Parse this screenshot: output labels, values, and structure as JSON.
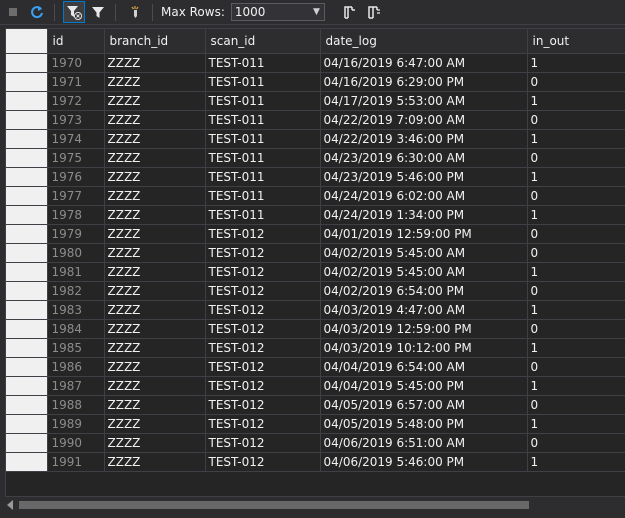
{
  "toolbar": {
    "max_rows_label": "Max Rows:",
    "max_rows_value": "1000"
  },
  "columns": [
    "id",
    "branch_id",
    "scan_id",
    "date_log",
    "in_out"
  ],
  "rows": [
    [
      "1970",
      "ZZZZ",
      "TEST-011",
      "04/16/2019 6:47:00 AM",
      "1"
    ],
    [
      "1971",
      "ZZZZ",
      "TEST-011",
      "04/16/2019 6:29:00 PM",
      "0"
    ],
    [
      "1972",
      "ZZZZ",
      "TEST-011",
      "04/17/2019 5:53:00 AM",
      "1"
    ],
    [
      "1973",
      "ZZZZ",
      "TEST-011",
      "04/22/2019 7:09:00 AM",
      "0"
    ],
    [
      "1974",
      "ZZZZ",
      "TEST-011",
      "04/22/2019 3:46:00 PM",
      "1"
    ],
    [
      "1975",
      "ZZZZ",
      "TEST-011",
      "04/23/2019 6:30:00 AM",
      "0"
    ],
    [
      "1976",
      "ZZZZ",
      "TEST-011",
      "04/23/2019 5:46:00 PM",
      "1"
    ],
    [
      "1977",
      "ZZZZ",
      "TEST-011",
      "04/24/2019 6:02:00 AM",
      "0"
    ],
    [
      "1978",
      "ZZZZ",
      "TEST-011",
      "04/24/2019 1:34:00 PM",
      "1"
    ],
    [
      "1979",
      "ZZZZ",
      "TEST-012",
      "04/01/2019 12:59:00 PM",
      "0"
    ],
    [
      "1980",
      "ZZZZ",
      "TEST-012",
      "04/02/2019 5:45:00 AM",
      "0"
    ],
    [
      "1981",
      "ZZZZ",
      "TEST-012",
      "04/02/2019 5:45:00 AM",
      "1"
    ],
    [
      "1982",
      "ZZZZ",
      "TEST-012",
      "04/02/2019 6:54:00 PM",
      "0"
    ],
    [
      "1983",
      "ZZZZ",
      "TEST-012",
      "04/03/2019 4:47:00 AM",
      "1"
    ],
    [
      "1984",
      "ZZZZ",
      "TEST-012",
      "04/03/2019 12:59:00 PM",
      "0"
    ],
    [
      "1985",
      "ZZZZ",
      "TEST-012",
      "04/03/2019 10:12:00 PM",
      "1"
    ],
    [
      "1986",
      "ZZZZ",
      "TEST-012",
      "04/04/2019 6:54:00 AM",
      "0"
    ],
    [
      "1987",
      "ZZZZ",
      "TEST-012",
      "04/04/2019 5:45:00 PM",
      "1"
    ],
    [
      "1988",
      "ZZZZ",
      "TEST-012",
      "04/05/2019 6:57:00 AM",
      "0"
    ],
    [
      "1989",
      "ZZZZ",
      "TEST-012",
      "04/05/2019 5:48:00 PM",
      "1"
    ],
    [
      "1990",
      "ZZZZ",
      "TEST-012",
      "04/06/2019 6:51:00 AM",
      "0"
    ],
    [
      "1991",
      "ZZZZ",
      "TEST-012",
      "04/06/2019 5:46:00 PM",
      "1"
    ]
  ],
  "icons": {
    "stop": "stop-icon",
    "refresh": "refresh-icon",
    "filter_clear": "filter-clear-icon",
    "filter": "filter-icon",
    "pin": "pin-icon",
    "script": "script-icon",
    "script_file": "script-file-icon"
  },
  "colors": {
    "accent": "#007acc",
    "background": "#252526"
  }
}
